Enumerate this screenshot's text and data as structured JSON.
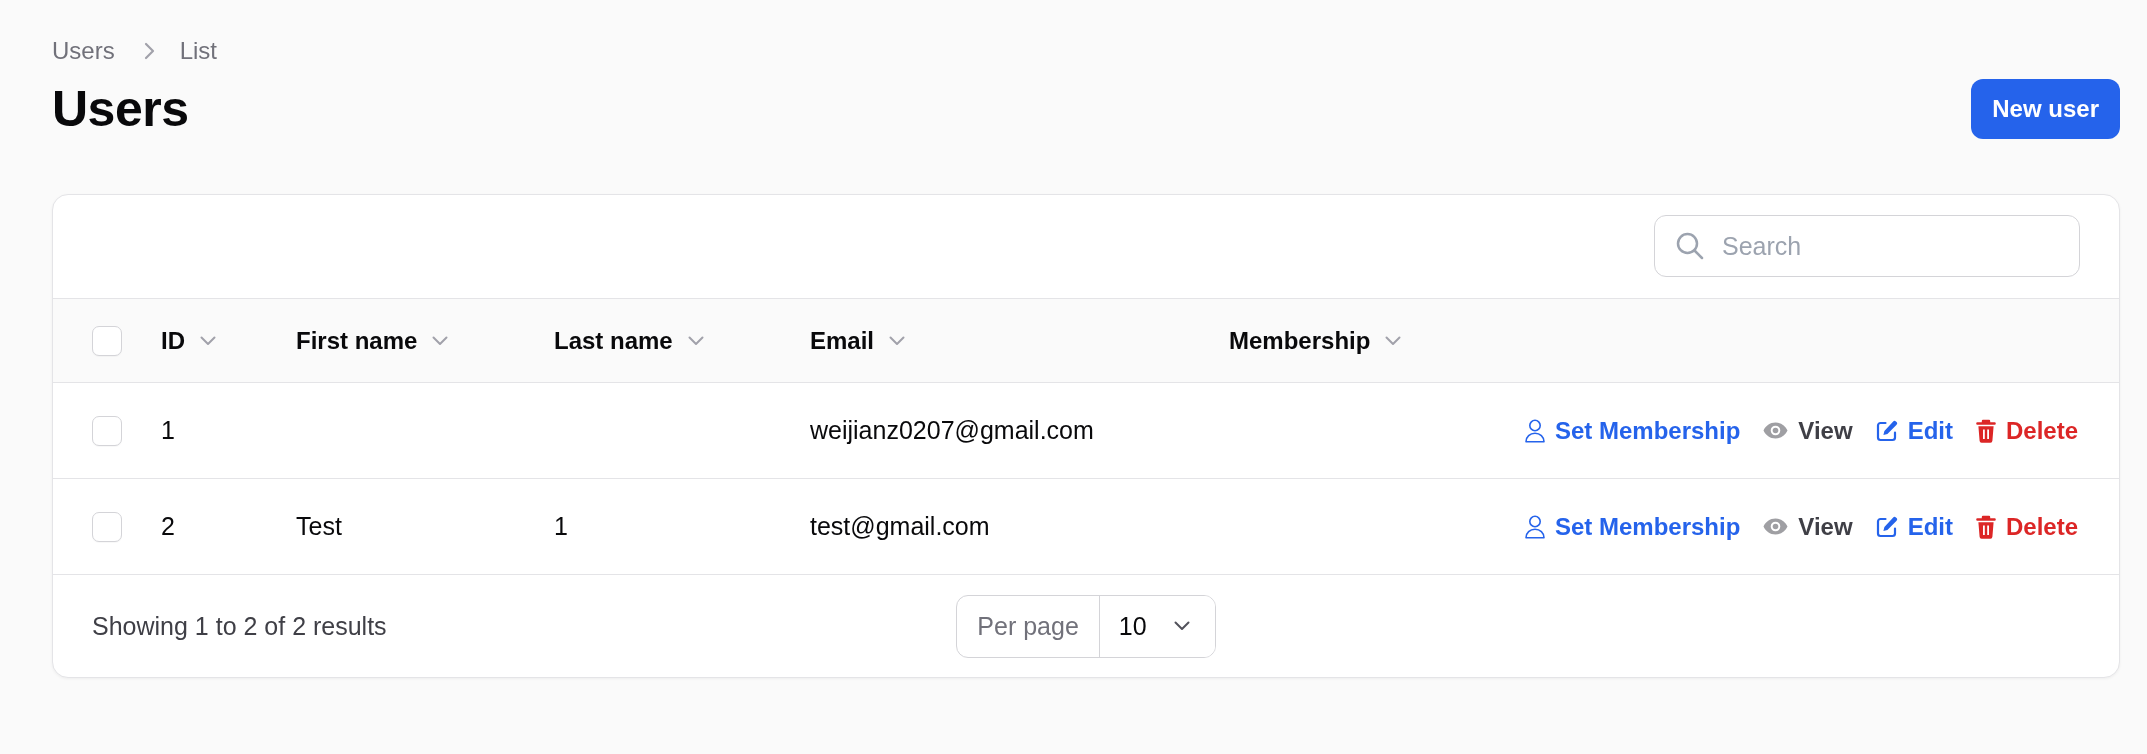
{
  "breadcrumbs": [
    {
      "label": "Users"
    },
    {
      "label": "List"
    }
  ],
  "header": {
    "title": "Users",
    "button": "New user"
  },
  "table": {
    "search": {
      "placeholder": "Search"
    },
    "select_all": {
      "checked": false
    },
    "columns": [
      {
        "label": "ID",
        "sortable": true
      },
      {
        "label": "First name",
        "sortable": true
      },
      {
        "label": "Last name",
        "sortable": true
      },
      {
        "label": "Email",
        "sortable": true
      },
      {
        "label": "Membership",
        "sortable": true
      }
    ],
    "rows": [
      {
        "selected": false,
        "id": "1",
        "email": "weijianz0207@gmail.com",
        "actions": [
          {
            "kind": "membership",
            "label": "Set Membership",
            "color": "#2563eb"
          },
          {
            "kind": "view",
            "label": "View",
            "color": "#3f3f46"
          },
          {
            "kind": "edit",
            "label": "Edit",
            "color": "#2563eb"
          },
          {
            "kind": "delete",
            "label": "Delete",
            "color": "#dc2626"
          }
        ]
      },
      {
        "selected": false,
        "id": "2",
        "first_name": "Test",
        "last_name": "1",
        "email": "test@gmail.com",
        "actions": [
          {
            "kind": "membership",
            "label": "Set Membership",
            "color": "#2563eb"
          },
          {
            "kind": "view",
            "label": "View",
            "color": "#3f3f46"
          },
          {
            "kind": "edit",
            "label": "Edit",
            "color": "#2563eb"
          },
          {
            "kind": "delete",
            "label": "Delete",
            "color": "#dc2626"
          }
        ]
      }
    ],
    "footer": {
      "summary": "Showing 1 to 2 of 2 results",
      "per_page": {
        "label": "Per page",
        "value": "10"
      }
    }
  }
}
